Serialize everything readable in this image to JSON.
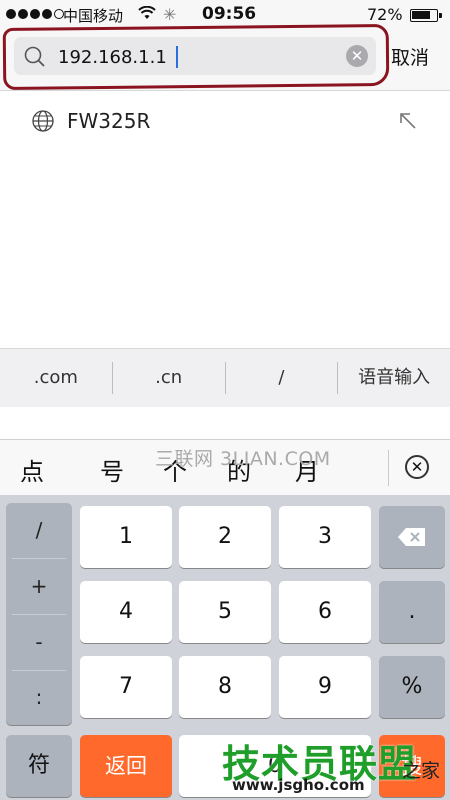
{
  "status_bar": {
    "carrier": "中国移动",
    "time": "09:56",
    "battery_percent": "72%",
    "battery_level": 0.72,
    "signal_bars": 4,
    "signal_total": 5
  },
  "search": {
    "value": "192.168.1.1",
    "cancel_label": "取消",
    "highlight_color": "#8a1420"
  },
  "suggestion": {
    "label": "FW325R",
    "icon": "globe-icon",
    "action_icon": "fill-arrow-icon"
  },
  "quick_keys": [
    ".com",
    ".cn",
    "/",
    "语音输入"
  ],
  "candidates": {
    "items": [
      "点",
      "号",
      "个",
      "的",
      "月"
    ],
    "watermark": "三联网 3LIAN.COM"
  },
  "keypad": {
    "side_keys": [
      "/",
      "+",
      "-",
      ":"
    ],
    "digits": [
      "1",
      "2",
      "3",
      "4",
      "5",
      "6",
      "7",
      "8",
      "9",
      "0"
    ],
    "dot": ".",
    "percent": "%",
    "symbols_label": "符",
    "back_label": "返回",
    "partial_right_label": "搜"
  },
  "overlay_brand": {
    "title": "技术员联盟",
    "url": "www.jsgho.com",
    "corner_text": "之家"
  },
  "colors": {
    "accent_orange": "#ff6a2c",
    "brand_green": "#1f9f2a",
    "caret_blue": "#2a6fe0"
  }
}
